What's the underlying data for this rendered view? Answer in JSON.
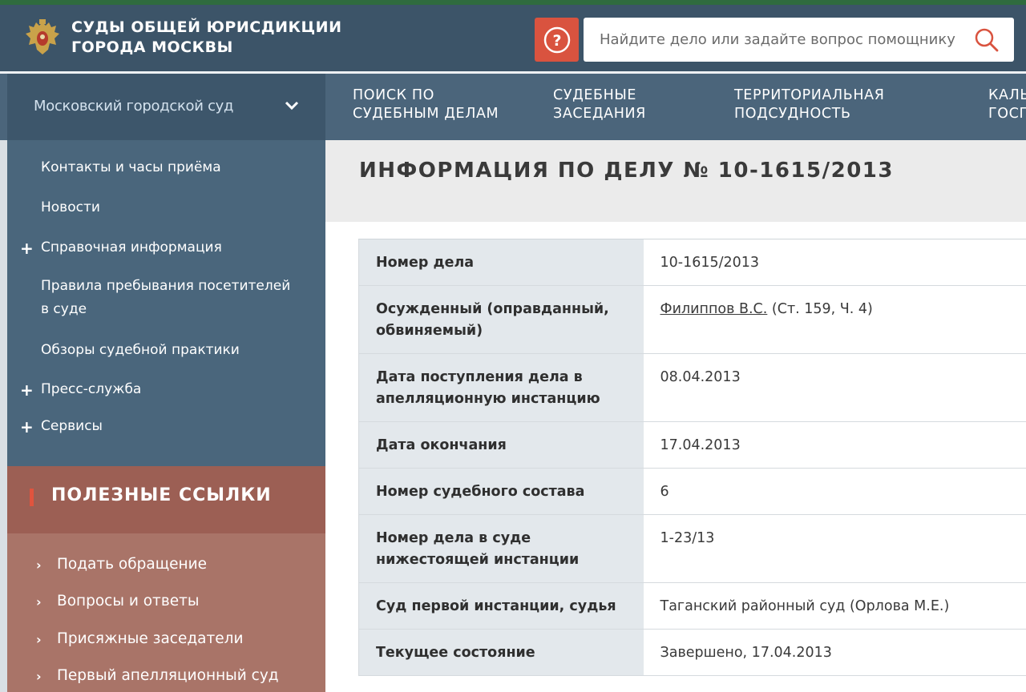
{
  "header": {
    "title_line1": "СУДЫ ОБЩЕЙ ЮРИСДИКЦИИ",
    "title_line2": "ГОРОДА МОСКВЫ",
    "search_placeholder": "Найдите дело или задайте вопрос помощнику",
    "help_symbol": "?"
  },
  "nav": {
    "court_select": "Московский городской суд",
    "items": [
      {
        "line1": "ПОИСК ПО",
        "line2": "СУДЕБНЫМ ДЕЛАМ"
      },
      {
        "line1": "СУДЕБНЫЕ",
        "line2": "ЗАСЕДАНИЯ"
      },
      {
        "line1": "ТЕРРИТОРИАЛЬНАЯ",
        "line2": "ПОДСУДНОСТЬ"
      },
      {
        "line1": "КАЛЬ",
        "line2": "ГОСП"
      }
    ]
  },
  "sidebar": {
    "items": [
      {
        "label": "Контакты и часы приёма",
        "plus": ""
      },
      {
        "label": "Новости",
        "plus": ""
      },
      {
        "label": "Справочная информация",
        "plus": "+"
      },
      {
        "label_line1": "Правила пребывания посетителей",
        "label_line2": "в суде",
        "plus": ""
      },
      {
        "label": "Обзоры судебной практики",
        "plus": ""
      },
      {
        "label": "Пресс-служба",
        "plus": "+"
      },
      {
        "label": "Сервисы",
        "plus": "+"
      }
    ]
  },
  "useful_links": {
    "title": "ПОЛЕЗНЫЕ ССЫЛКИ",
    "items": [
      "Подать обращение",
      "Вопросы и ответы",
      "Присяжные заседатели",
      "Первый апелляционный суд"
    ]
  },
  "main": {
    "title": "ИНФОРМАЦИЯ ПО ДЕЛУ № 10-1615/2013",
    "rows": [
      {
        "label": "Номер дела",
        "value": "10-1615/2013"
      },
      {
        "label": "Осужденный (оправданный, обвиняемый)",
        "value_link": "Филиппов В.С.",
        "value_rest": " (Ст. 159, Ч. 4)"
      },
      {
        "label": "Дата поступления дела в апелляционную инстанцию",
        "value": "08.04.2013"
      },
      {
        "label": "Дата окончания",
        "value": "17.04.2013"
      },
      {
        "label": "Номер судебного состава",
        "value": "6"
      },
      {
        "label": "Номер дела в суде нижестоящей инстанции",
        "value": "1-23/13"
      },
      {
        "label": "Суд первой инстанции, судья",
        "value": "Таганский районный суд (Орлова М.Е.)"
      },
      {
        "label": "Текущее состояние",
        "value": "Завершено, 17.04.2013"
      }
    ]
  },
  "colors": {
    "header_bg": "#3c5468",
    "nav_bg": "#4b657b",
    "sidebar_bg": "#4a667c",
    "accent_red": "#d9533f",
    "useful_bg": "#9c5f54"
  }
}
